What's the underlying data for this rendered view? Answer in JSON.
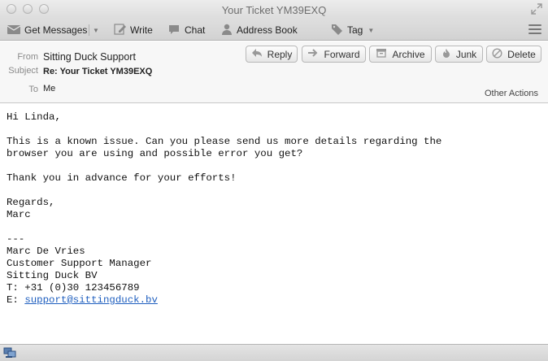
{
  "window": {
    "title": "Your Ticket YM39EXQ"
  },
  "toolbar": {
    "get_messages": "Get Messages",
    "write": "Write",
    "chat": "Chat",
    "address_book": "Address Book",
    "tag": "Tag"
  },
  "header": {
    "from_label": "From",
    "from_value": "Sitting Duck Support",
    "subject_label": "Subject",
    "subject_value": "Re: Your Ticket YM39EXQ",
    "to_label": "To",
    "to_value": "Me",
    "buttons": {
      "reply": "Reply",
      "forward": "Forward",
      "archive": "Archive",
      "junk": "Junk",
      "delete": "Delete"
    },
    "other_actions": "Other Actions"
  },
  "body": {
    "greeting": "Hi Linda,",
    "para1_line1": "This is a known issue. Can you please send us more details regarding the",
    "para1_line2": "browser you are using and possible error you get?",
    "thanks": "Thank you in advance for your efforts!",
    "regards": "Regards,",
    "sender_first": "Marc",
    "sig_sep": "---",
    "sig_name": "Marc De Vries",
    "sig_title": "Customer Support Manager",
    "sig_company": "Sitting Duck BV",
    "sig_phone": "T: +31 (0)30 123456789",
    "sig_email_prefix": "E: ",
    "sig_email": "support@sittingduck.bv"
  }
}
